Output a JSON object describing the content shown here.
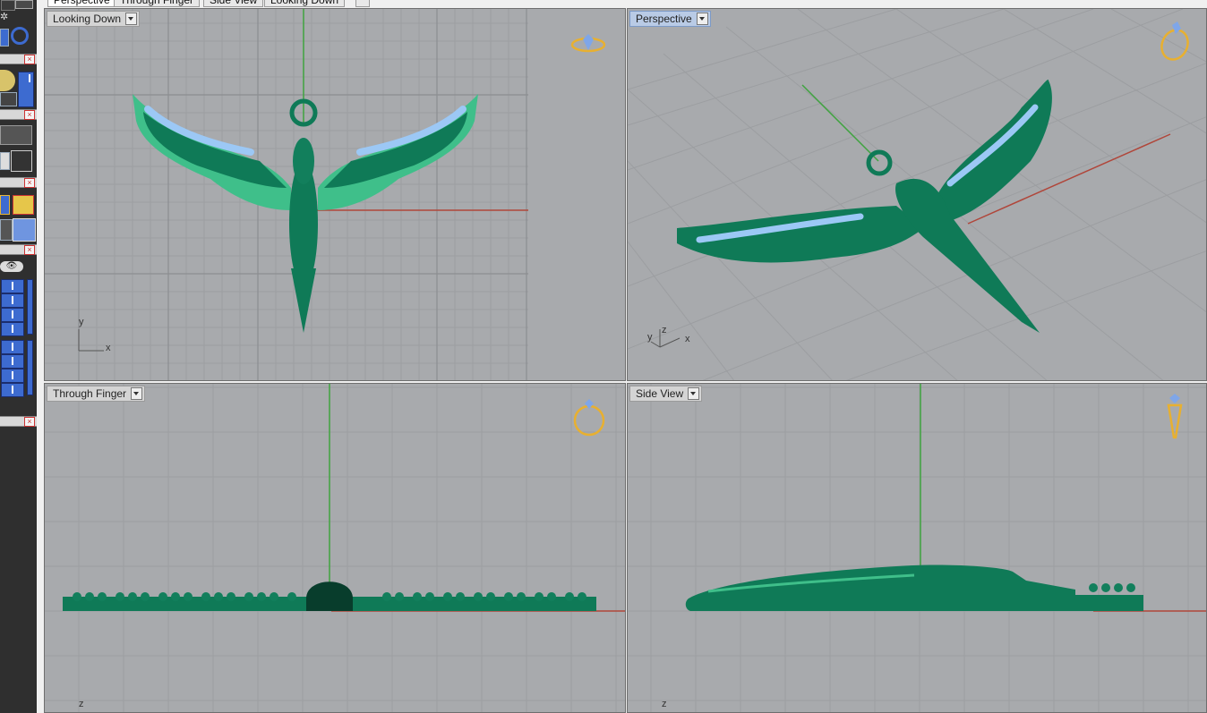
{
  "tabs": [
    {
      "label": "Perspective",
      "active": true
    },
    {
      "label": "Through Finger",
      "active": false
    },
    {
      "label": "Side View",
      "active": false
    },
    {
      "label": "Looking Down",
      "active": false
    }
  ],
  "viewports": {
    "top_left": {
      "label": "Looking Down",
      "icon": "ring-top-icon",
      "axis_v": "y",
      "axis_h": "x"
    },
    "top_right": {
      "label": "Perspective",
      "icon": "ring-perspective-icon",
      "axis_v": "y",
      "axis_z": "z",
      "axis_h": "x"
    },
    "bottom_left": {
      "label": "Through Finger",
      "icon": "ring-front-icon",
      "axis_v": "z"
    },
    "bottom_right": {
      "label": "Side View",
      "icon": "ring-side-icon",
      "axis_v": "z"
    }
  },
  "colors": {
    "viewport_bg": "#a8aaad",
    "grid_minor": "#9c9ea1",
    "grid_major": "#8c8e91",
    "model_green": "#0f7a57",
    "model_light": "#3fbf8a",
    "gem_blue": "#9cc8f5",
    "axis_red": "#b0463a",
    "axis_green": "#3fa33f",
    "icon_gold": "#e8b030"
  }
}
